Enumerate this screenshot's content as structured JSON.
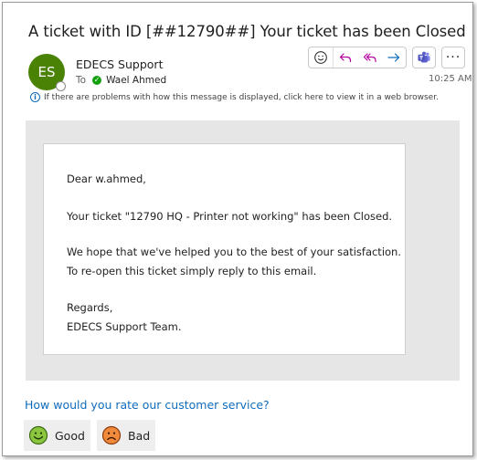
{
  "email": {
    "subject": "A ticket with ID [##12790##]  Your ticket has been Closed",
    "sender_initials": "ES",
    "sender_name": "EDECS Support",
    "to_label": "To",
    "recipient": "Wael Ahmed",
    "time": "10:25 AM",
    "info_message": "If there are problems with how this message is displayed, click here to view it in a web browser."
  },
  "actions": {
    "emoji_icon": "emoji-icon",
    "reply_icon": "reply-icon",
    "reply_all_icon": "reply-all-icon",
    "forward_icon": "forward-icon",
    "teams_icon": "teams-icon",
    "more_label": "···"
  },
  "body": {
    "greeting": "Dear w.ahmed,",
    "status_line": "Your ticket \"12790 HQ - Printer not working\" has been Closed.",
    "hope_line": "We hope that we've helped you to the best of your satisfaction.",
    "reopen_line": "To re-open this ticket simply reply to this email.",
    "regards": "Regards,",
    "signature": "EDECS Support Team."
  },
  "rating": {
    "question": "How would you rate our customer service?",
    "good_label": "Good",
    "bad_label": "Bad"
  },
  "colors": {
    "avatar": "#498205",
    "link": "#0f6cbd",
    "reply_accent": "#b4009e",
    "forward_accent": "#0f6cbd",
    "teams": "#5b5fc7"
  }
}
